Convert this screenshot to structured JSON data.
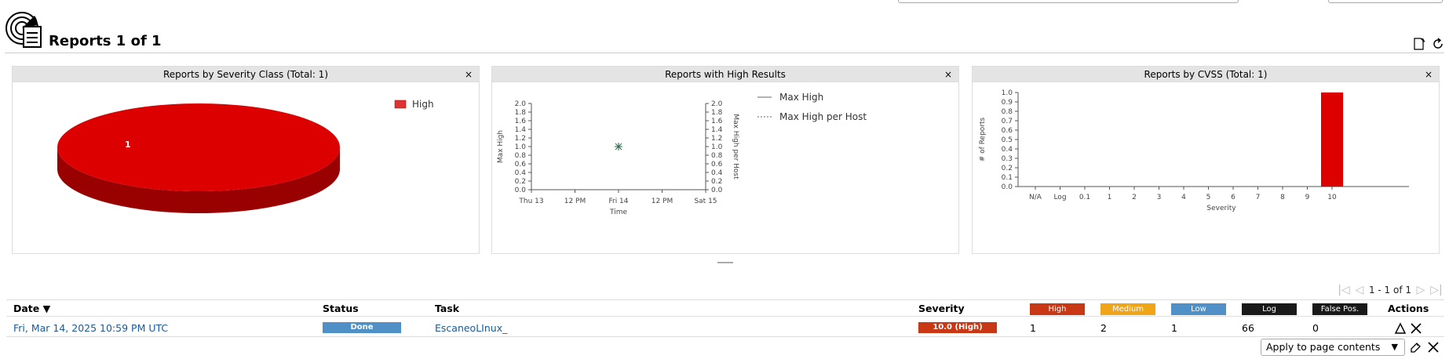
{
  "page": {
    "title": "Reports 1 of 1"
  },
  "panels": {
    "severity_class": {
      "title": "Reports by Severity Class (Total: 1)",
      "close": "×"
    },
    "high_results": {
      "title": "Reports with High Results",
      "close": "×"
    },
    "cvss": {
      "title": "Reports by CVSS (Total: 1)",
      "close": "×"
    }
  },
  "chart_data": [
    {
      "type": "pie",
      "title": "Reports by Severity Class (Total: 1)",
      "categories": [
        "High"
      ],
      "values": [
        1
      ],
      "slice_labels": [
        "1"
      ],
      "legend": [
        "High"
      ],
      "colors": [
        "#dd0000"
      ]
    },
    {
      "type": "line",
      "title": "Reports with High Results",
      "xlabel": "Time",
      "ylabel": "Max High",
      "y2label": "Max High per Host",
      "x_ticks": [
        "Thu 13",
        "12 PM",
        "Fri 14",
        "12 PM",
        "Sat 15"
      ],
      "y_ticks": [
        "0.0",
        "0.2",
        "0.4",
        "0.6",
        "0.8",
        "1.0",
        "1.2",
        "1.4",
        "1.6",
        "1.8",
        "2.0"
      ],
      "ylim": [
        0,
        2
      ],
      "series": [
        {
          "name": "Max High",
          "points": [
            {
              "x": "Fri 14",
              "y": 1.0
            }
          ]
        },
        {
          "name": "Max High per Host",
          "points": [
            {
              "x": "Fri 14",
              "y": 1.0
            }
          ]
        }
      ]
    },
    {
      "type": "bar",
      "title": "Reports by CVSS (Total: 1)",
      "xlabel": "Severity",
      "ylabel": "# of Reports",
      "categories": [
        "N/A",
        "Log",
        "0.1",
        "1",
        "2",
        "3",
        "4",
        "5",
        "6",
        "7",
        "8",
        "9",
        "10"
      ],
      "values": [
        0,
        0,
        0,
        0,
        0,
        0,
        0,
        0,
        0,
        0,
        0,
        0,
        1
      ],
      "y_ticks": [
        "0.0",
        "0.1",
        "0.2",
        "0.3",
        "0.4",
        "0.5",
        "0.6",
        "0.7",
        "0.8",
        "0.9",
        "1.0"
      ],
      "ylim": [
        0,
        1
      ],
      "color": "#dd0000"
    }
  ],
  "pagination": {
    "text": "1 - 1 of 1"
  },
  "table": {
    "headers": {
      "date": "Date ▼",
      "status": "Status",
      "task": "Task",
      "severity": "Severity",
      "high": "High",
      "medium": "Medium",
      "low": "Low",
      "log": "Log",
      "false_pos": "False Pos.",
      "actions": "Actions"
    },
    "colors": {
      "high": "#c83814",
      "medium": "#f0a519",
      "low": "#4f91c7",
      "log": "#191919",
      "false_pos": "#191919",
      "done": "#4f91c7",
      "sev_badge": "#c83814"
    },
    "rows": [
      {
        "date": "Fri, Mar 14, 2025 10:59 PM UTC",
        "status": "Done",
        "task": "EscaneoLInux_",
        "severity": "10.0 (High)",
        "high": "1",
        "medium": "2",
        "low": "1",
        "log": "66",
        "false_pos": "0"
      }
    ]
  },
  "bulk": {
    "apply_label": "Apply to page contents"
  }
}
